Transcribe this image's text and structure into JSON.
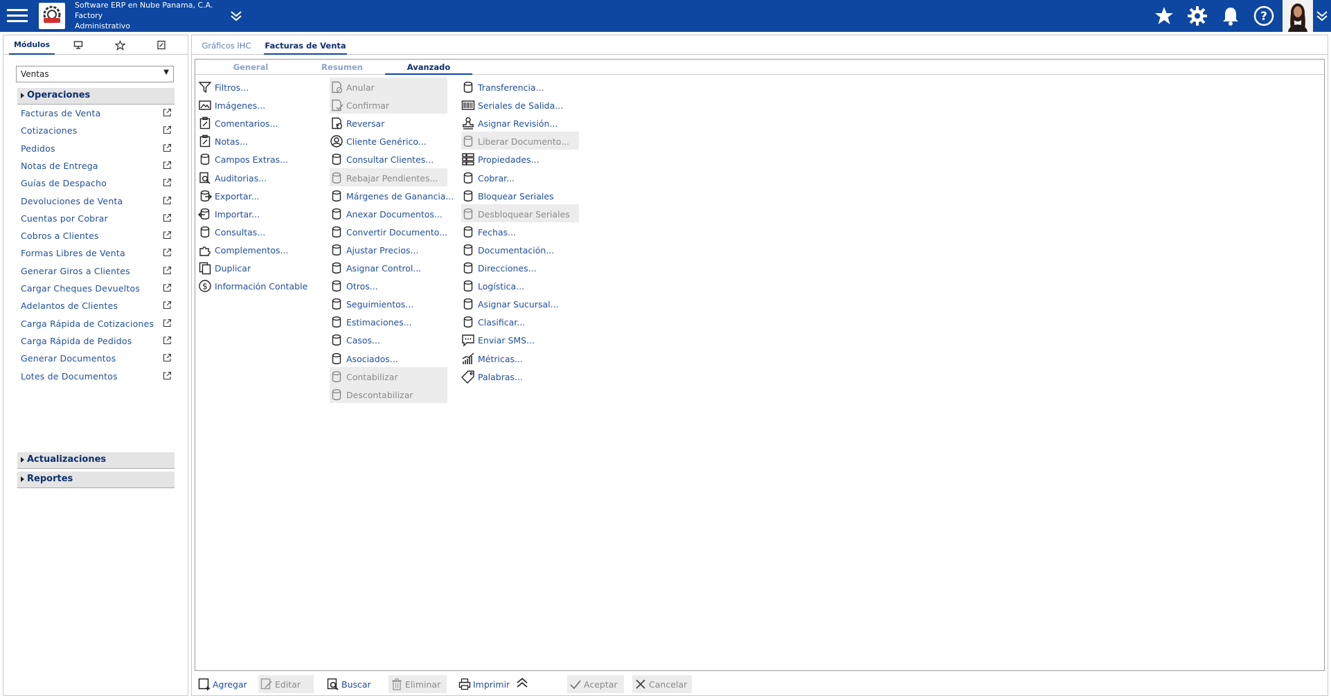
{
  "header": {
    "company_line1": "Software ERP en Nube Panama, C.A.",
    "company_line2": "Factory",
    "company_line3": "Administrativo"
  },
  "sidebar": {
    "tab_modulos": "Módulos",
    "select_value": "Ventas",
    "groups": {
      "operaciones": "Operaciones",
      "actualizaciones": "Actualizaciones",
      "reportes": "Reportes"
    },
    "items": [
      "Facturas de Venta",
      "Cotizaciones",
      "Pedidos",
      "Notas de Entrega",
      "Guías de Despacho",
      "Devoluciones de Venta",
      "Cuentas por Cobrar",
      "Cobros a Clientes",
      "Formas Libres de Venta",
      "Generar Giros a Clientes",
      "Cargar Cheques Devueltos",
      "Adelantos de Clientes",
      "Carga Rápida de Cotizaciones",
      "Carga Rápida de Pedidos",
      "Generar Documentos",
      "Lotes de Documentos"
    ]
  },
  "main": {
    "tabs": [
      "Gráficos IHC",
      "Facturas de Venta"
    ],
    "sub_tabs": [
      "General",
      "Resumen",
      "Avanzado"
    ],
    "col1": [
      {
        "label": "Filtros...",
        "icon": "filter-icon",
        "disabled": false
      },
      {
        "label": "Imágenes...",
        "icon": "image-icon",
        "disabled": false
      },
      {
        "label": "Comentarios...",
        "icon": "clipboard-icon",
        "disabled": false
      },
      {
        "label": "Notas...",
        "icon": "clipboard-icon",
        "disabled": false
      },
      {
        "label": "Campos Extras...",
        "icon": "database-icon",
        "disabled": false
      },
      {
        "label": "Auditorias...",
        "icon": "audit-icon",
        "disabled": false
      },
      {
        "label": "Exportar...",
        "icon": "export-icon",
        "disabled": false
      },
      {
        "label": "Importar...",
        "icon": "import-icon",
        "disabled": false
      },
      {
        "label": "Consultas...",
        "icon": "database-icon",
        "disabled": false
      },
      {
        "label": "Complementos...",
        "icon": "puzzle-icon",
        "disabled": false
      },
      {
        "label": "Duplicar",
        "icon": "duplicate-icon",
        "disabled": false
      },
      {
        "label": "Información Contable",
        "icon": "dollar-icon",
        "disabled": false
      }
    ],
    "col2": [
      {
        "label": "Anular",
        "icon": "cancel-doc-icon",
        "disabled": true
      },
      {
        "label": "Confirmar",
        "icon": "confirm-doc-icon",
        "disabled": true
      },
      {
        "label": "Reversar",
        "icon": "reverse-doc-icon",
        "disabled": false
      },
      {
        "label": "Cliente Genérico...",
        "icon": "user-circle-icon",
        "disabled": false
      },
      {
        "label": "Consultar Clientes...",
        "icon": "database-icon",
        "disabled": false
      },
      {
        "label": "Rebajar Pendientes...",
        "icon": "database-icon",
        "disabled": true
      },
      {
        "label": "Márgenes de Ganancia...",
        "icon": "database-icon",
        "disabled": false
      },
      {
        "label": "Anexar Documentos...",
        "icon": "database-icon",
        "disabled": false
      },
      {
        "label": "Convertir Documento...",
        "icon": "database-icon",
        "disabled": false
      },
      {
        "label": "Ajustar Precios...",
        "icon": "database-icon",
        "disabled": false
      },
      {
        "label": "Asignar Control...",
        "icon": "database-icon",
        "disabled": false
      },
      {
        "label": "Otros...",
        "icon": "database-icon",
        "disabled": false
      },
      {
        "label": "Seguimientos...",
        "icon": "database-icon",
        "disabled": false
      },
      {
        "label": "Estimaciones...",
        "icon": "database-icon",
        "disabled": false
      },
      {
        "label": "Casos...",
        "icon": "database-icon",
        "disabled": false
      },
      {
        "label": "Asociados...",
        "icon": "database-icon",
        "disabled": false
      },
      {
        "label": "Contabilizar",
        "icon": "database-icon",
        "disabled": true
      },
      {
        "label": "Descontabilizar",
        "icon": "database-icon",
        "disabled": true
      }
    ],
    "col3": [
      {
        "label": "Transferencia...",
        "icon": "database-icon",
        "disabled": false
      },
      {
        "label": "Seriales de Salida...",
        "icon": "barcode-icon",
        "disabled": false
      },
      {
        "label": "Asignar Revisión...",
        "icon": "stamp-icon",
        "disabled": false
      },
      {
        "label": "Liberar Documento...",
        "icon": "database-icon",
        "disabled": true
      },
      {
        "label": "Propiedades...",
        "icon": "properties-icon",
        "disabled": false
      },
      {
        "label": "Cobrar...",
        "icon": "database-icon",
        "disabled": false
      },
      {
        "label": "Bloquear Seriales",
        "icon": "database-icon",
        "disabled": false
      },
      {
        "label": "Desbloquear Seriales",
        "icon": "database-icon",
        "disabled": true
      },
      {
        "label": "Fechas...",
        "icon": "database-icon",
        "disabled": false
      },
      {
        "label": "Documentación...",
        "icon": "database-icon",
        "disabled": false
      },
      {
        "label": "Direcciones...",
        "icon": "database-icon",
        "disabled": false
      },
      {
        "label": "Logística...",
        "icon": "database-icon",
        "disabled": false
      },
      {
        "label": "Asignar Sucursal...",
        "icon": "database-icon",
        "disabled": false
      },
      {
        "label": "Clasificar...",
        "icon": "database-icon",
        "disabled": false
      },
      {
        "label": "Enviar SMS...",
        "icon": "sms-icon",
        "disabled": false
      },
      {
        "label": "Métricas...",
        "icon": "metrics-icon",
        "disabled": false
      },
      {
        "label": "Palabras...",
        "icon": "tag-icon",
        "disabled": false
      }
    ]
  },
  "toolbar": {
    "agregar": "Agregar",
    "editar": "Editar",
    "buscar": "Buscar",
    "eliminar": "Eliminar",
    "imprimir": "Imprimir",
    "aceptar": "Aceptar",
    "cancelar": "Cancelar"
  },
  "colors": {
    "topbar": "#0d47a1",
    "link": "#1f4e9a",
    "disabled_bg": "#ececec"
  }
}
